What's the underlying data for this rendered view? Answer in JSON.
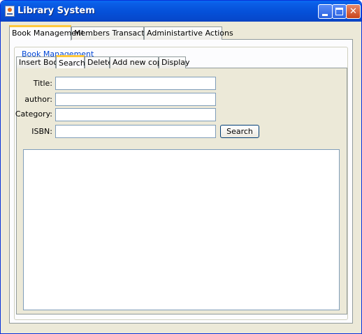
{
  "window": {
    "title": "Library System"
  },
  "outer_tabs": [
    {
      "label": "Book Management",
      "selected": true
    },
    {
      "label": "Members Transactions",
      "selected": false
    },
    {
      "label": "Administartive Actions",
      "selected": false
    }
  ],
  "group": {
    "title": "Book Management"
  },
  "inner_tabs": [
    {
      "label": "Insert Book",
      "selected": false
    },
    {
      "label": "Search",
      "selected": true
    },
    {
      "label": "Delete",
      "selected": false
    },
    {
      "label": "Add new copy",
      "selected": false
    },
    {
      "label": "Display",
      "selected": false
    }
  ],
  "form": {
    "title_label": "Title:",
    "title_value": "",
    "author_label": "author:",
    "author_value": "",
    "category_label": "Category:",
    "category_value": "",
    "isbn_label": "ISBN:",
    "isbn_value": "",
    "search_button": "Search"
  },
  "colors": {
    "titlebar": "#0550d8",
    "group_title": "#0046d5",
    "selected_tab_accent": "#ffc83c"
  }
}
